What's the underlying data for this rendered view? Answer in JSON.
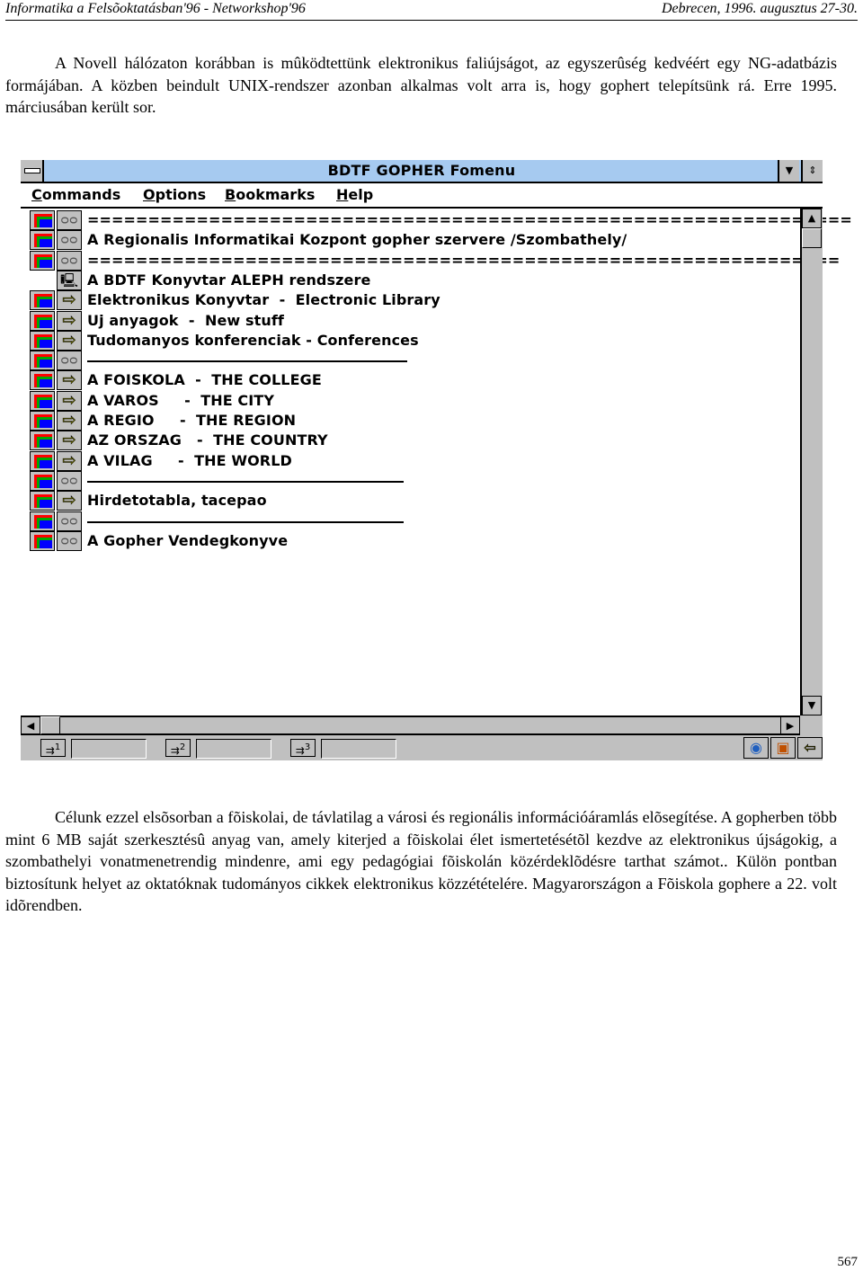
{
  "page_header": {
    "left": "Informatika a Felsõoktatásban'96 - Networkshop'96",
    "right": "Debrecen, 1996. augusztus 27-30."
  },
  "paragraph1": "A Novell hálózaton korábban is mûködtettünk elektronikus faliújságot, az egyszerûség kedvéért egy NG-adatbázis formájában. A közben beindult UNIX-rendszer azonban alkalmas volt arra is, hogy gophert telepítsünk rá. Erre 1995. márciusában került sor.",
  "gopher_window": {
    "title": "BDTF GOPHER Fomenu",
    "menu": [
      {
        "accel": "C",
        "rest": "ommands"
      },
      {
        "accel": "O",
        "rest": "ptions"
      },
      {
        "accel": "B",
        "rest": "ookmarks"
      },
      {
        "accel": "H",
        "rest": "elp"
      }
    ],
    "items": [
      {
        "type": "text",
        "icon": "glasses-icon",
        "label": "==============================================================="
      },
      {
        "type": "text",
        "icon": "glasses-icon",
        "label": "A Regionalis Informatikai Kozpont gopher szervere /Szombathely/"
      },
      {
        "type": "text",
        "icon": "glasses-icon",
        "label": "=============================================================="
      },
      {
        "type": "telnet",
        "icon": "terminal-icon",
        "label": "A BDTF Konyvtar ALEPH rendszere"
      },
      {
        "type": "directory",
        "icon": "arrow-icon",
        "label": "Elektronikus Konyvtar  -  Electronic Library"
      },
      {
        "type": "directory",
        "icon": "arrow-icon",
        "label": "Uj anyagok  -  New stuff"
      },
      {
        "type": "directory",
        "icon": "arrow-icon",
        "label": "Tudomanyos konferenciak - Conferences"
      },
      {
        "type": "rule",
        "icon": "glasses-icon",
        "label": ""
      },
      {
        "type": "directory",
        "icon": "arrow-icon",
        "label": "A FOISKOLA  -  THE COLLEGE"
      },
      {
        "type": "directory",
        "icon": "arrow-icon",
        "label": "A VAROS     -  THE CITY"
      },
      {
        "type": "directory",
        "icon": "arrow-icon",
        "label": "A REGIO     -  THE REGION"
      },
      {
        "type": "directory",
        "icon": "arrow-icon",
        "label": "AZ ORSZAG   -  THE COUNTRY"
      },
      {
        "type": "directory",
        "icon": "arrow-icon",
        "label": "A VILAG     -  THE WORLD"
      },
      {
        "type": "rule",
        "icon": "glasses-icon",
        "label": ""
      },
      {
        "type": "directory",
        "icon": "arrow-icon",
        "label": "Hirdetotabla, tacepao"
      },
      {
        "type": "rule",
        "icon": "glasses-icon",
        "label": ""
      },
      {
        "type": "text",
        "icon": "glasses-icon",
        "label": "A Gopher Vendegkonyve"
      }
    ],
    "history_buttons": [
      "1",
      "2",
      "3"
    ],
    "history_fields": [
      "",
      "",
      ""
    ]
  },
  "paragraph2": "Célunk ezzel elsõsorban a fõiskolai, de távlatilag a városi és regionális információáramlás elõsegítése. A gopherben több mint 6 MB saját szerkesztésû anyag van, amely kiterjed a fõiskolai élet ismertetésétõl kezdve az elektronikus újságokig, a szombathelyi vonatmenetrendig mindenre, ami egy pedagógiai fõiskolán közérdeklõdésre tarthat számot.. Külön pontban biztosítunk helyet az oktatóknak tudományos cikkek elektronikus közzétételére. Magyarországon a Fõiskola gophere a 22. volt idõrendben.",
  "page_number": "567"
}
